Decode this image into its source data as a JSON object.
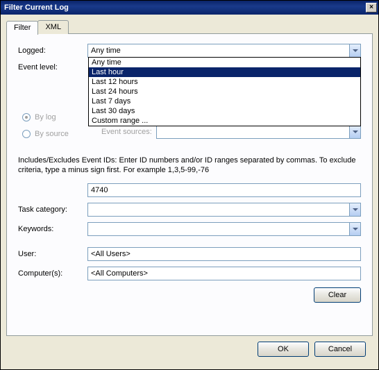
{
  "title": "Filter Current Log",
  "tabs": {
    "filter": "Filter",
    "xml": "XML"
  },
  "labels": {
    "logged": "Logged:",
    "event_level": "Event level:",
    "by_log": "By log",
    "by_source": "By source",
    "event_sources": "Event sources:",
    "task_category": "Task category:",
    "keywords": "Keywords:",
    "user": "User:",
    "computers": "Computer(s):"
  },
  "logged": {
    "value": "Any time",
    "options": [
      "Any time",
      "Last hour",
      "Last 12 hours",
      "Last 24 hours",
      "Last 7 days",
      "Last 30 days",
      "Custom range ..."
    ],
    "highlighted_index": 1
  },
  "desc": "Includes/Excludes Event IDs: Enter ID numbers and/or ID ranges separated by commas. To exclude criteria, type a minus sign first. For example 1,3,5-99,-76",
  "event_id_value": "4740",
  "user_value": "<All Users>",
  "computers_value": "<All Computers>",
  "buttons": {
    "clear": "Clear",
    "ok": "OK",
    "cancel": "Cancel"
  }
}
